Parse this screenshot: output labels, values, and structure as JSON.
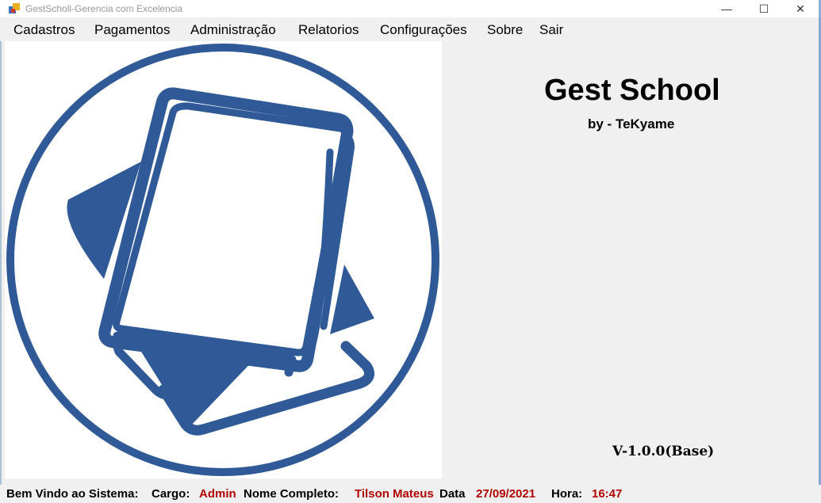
{
  "window": {
    "title": "GestScholl-Gerencia com Excelencia",
    "minimize_glyph": "—",
    "maximize_glyph": "☐",
    "close_glyph": "✕"
  },
  "menu": {
    "items": [
      {
        "label": "Cadastros"
      },
      {
        "label": "Pagamentos"
      },
      {
        "label": "Administração"
      },
      {
        "label": "Relatorios"
      },
      {
        "label": "Configurações"
      },
      {
        "label": "Sobre"
      },
      {
        "label": "Sair"
      }
    ]
  },
  "logo": {
    "icon": "book-logo-icon",
    "color": "#2f5a97"
  },
  "app": {
    "title": "Gest School",
    "author": "by - TeKyame",
    "version": "V-1.0.0(Base)"
  },
  "status": {
    "welcome_label": "Bem Vindo ao Sistema:",
    "role_label": "Cargo:",
    "role_value": "Admin",
    "name_label": "Nome Completo:",
    "name_value": "Tilson Mateus",
    "date_label": "Data",
    "date_value": "27/09/2021",
    "time_label": "Hora:",
    "time_value": "16:47",
    "value_color": "#b00000"
  }
}
